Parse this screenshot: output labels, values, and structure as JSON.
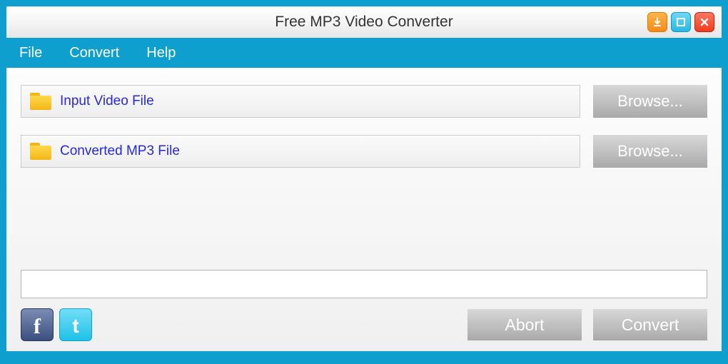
{
  "titlebar": {
    "title": "Free MP3 Video Converter"
  },
  "menubar": {
    "file": "File",
    "convert": "Convert",
    "help": "Help"
  },
  "inputRow": {
    "label": "Input Video File",
    "button": "Browse..."
  },
  "outputRow": {
    "label": "Converted MP3 File",
    "button": "Browse..."
  },
  "footer": {
    "abort": "Abort",
    "convert": "Convert"
  }
}
